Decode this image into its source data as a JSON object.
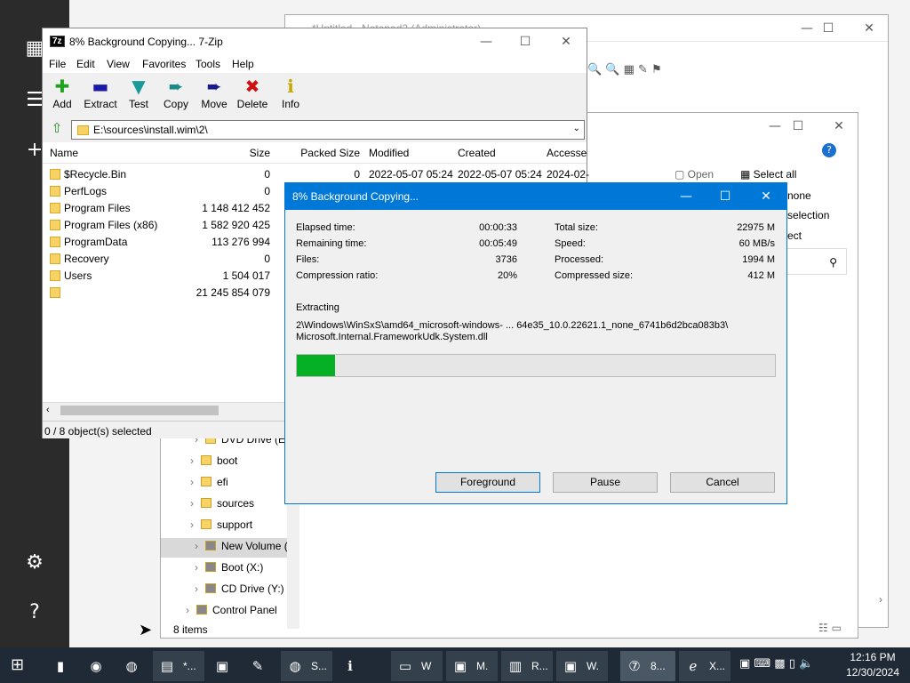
{
  "left_panel": {
    "icons": [
      "grid-icon",
      "menu-icon",
      "plus-icon",
      "sliders-icon",
      "help-icon"
    ]
  },
  "notepad": {
    "title": "*Untitled - Notepad2 (Administrator)"
  },
  "explorer": {
    "ribbon": {
      "open": "Open",
      "select_all": "Select all",
      "select_none": "none",
      "invert": "selection",
      "select_label": "ect"
    },
    "tree": [
      {
        "label": "DVD Drive (E:)"
      },
      {
        "label": "boot"
      },
      {
        "label": "efi"
      },
      {
        "label": "sources"
      },
      {
        "label": "support"
      },
      {
        "label": "New Volume (F"
      },
      {
        "label": "Boot (X:)"
      },
      {
        "label": "CD Drive (Y:) H"
      },
      {
        "label": "Control Panel"
      }
    ],
    "status": "8 items"
  },
  "sevenzip": {
    "title": "8% Background Copying... 7-Zip",
    "menu": [
      "File",
      "Edit",
      "View",
      "Favorites",
      "Tools",
      "Help"
    ],
    "toolbar": [
      {
        "label": "Add",
        "icon": "plus-icon",
        "color": "#1fa31f"
      },
      {
        "label": "Extract",
        "icon": "minus-icon",
        "color": "#1a1aa8"
      },
      {
        "label": "Test",
        "icon": "check-icon",
        "color": "#1a9a9a"
      },
      {
        "label": "Copy",
        "icon": "arrow-right-icon",
        "color": "#1a8a8a"
      },
      {
        "label": "Move",
        "icon": "arrow-right-icon",
        "color": "#1a1a8a"
      },
      {
        "label": "Delete",
        "icon": "x-icon",
        "color": "#d01010"
      },
      {
        "label": "Info",
        "icon": "info-icon",
        "color": "#c9a600"
      }
    ],
    "address": "E:\\sources\\install.wim\\2\\",
    "columns": [
      "Name",
      "Size",
      "Packed Size",
      "Modified",
      "Created",
      "Accesse"
    ],
    "rows": [
      {
        "name": "$Recycle.Bin",
        "size": "0",
        "packed": "0",
        "modified": "2022-05-07 05:24",
        "created": "2022-05-07 05:24",
        "accessed": "2024-02-"
      },
      {
        "name": "PerfLogs",
        "size": "0",
        "packed": "",
        "modified": "",
        "created": "",
        "accessed": ""
      },
      {
        "name": "Program Files",
        "size": "1 148 412 452",
        "packed": "",
        "modified": "",
        "created": "",
        "accessed": ""
      },
      {
        "name": "Program Files (x86)",
        "size": "1 582 920 425",
        "packed": "",
        "modified": "",
        "created": "",
        "accessed": ""
      },
      {
        "name": "ProgramData",
        "size": "113 276 994",
        "packed": "",
        "modified": "",
        "created": "",
        "accessed": ""
      },
      {
        "name": "Recovery",
        "size": "0",
        "packed": "",
        "modified": "",
        "created": "",
        "accessed": ""
      },
      {
        "name": "Users",
        "size": "1 504 017",
        "packed": "",
        "modified": "",
        "created": "",
        "accessed": ""
      },
      {
        "name": "",
        "size": "21 245 854 079",
        "packed": "",
        "modified": "",
        "created": "",
        "accessed": ""
      }
    ],
    "status": "0 / 8 object(s) selected"
  },
  "progress": {
    "title": "8% Background Copying...",
    "left": [
      {
        "label": "Elapsed time:",
        "value": "00:00:33"
      },
      {
        "label": "Remaining time:",
        "value": "00:05:49"
      },
      {
        "label": "Files:",
        "value": "3736"
      },
      {
        "label": "Compression ratio:",
        "value": "20%"
      }
    ],
    "right": [
      {
        "label": "Total size:",
        "value": "22975 M"
      },
      {
        "label": "Speed:",
        "value": "60 MB/s"
      },
      {
        "label": "Processed:",
        "value": "1994 M"
      },
      {
        "label": "Compressed size:",
        "value": "412 M"
      }
    ],
    "action": "Extracting",
    "path_line1": "2\\Windows\\WinSxS\\amd64_microsoft-windows- ... 64e35_10.0.22621.1_none_6741b6d2bca083b3\\",
    "path_line2": "Microsoft.Internal.FrameworkUdk.System.dll",
    "percent": 8,
    "buttons": {
      "foreground": "Foreground",
      "pause": "Pause",
      "cancel": "Cancel"
    }
  },
  "taskbar": {
    "items": [
      {
        "icon": "cmd-icon",
        "text": ""
      },
      {
        "icon": "chrome-icon",
        "text": ""
      },
      {
        "icon": "firefox-icon",
        "text": ""
      },
      {
        "icon": "notepad-icon",
        "text": "*..."
      },
      {
        "icon": "app-icon",
        "text": ""
      },
      {
        "icon": "paint-icon",
        "text": ""
      },
      {
        "icon": "firefox-icon",
        "text": "S..."
      },
      {
        "icon": "info-icon",
        "text": ""
      },
      {
        "icon": "drive-icon",
        "text": "W"
      },
      {
        "icon": "app-icon",
        "text": "M."
      },
      {
        "icon": "chart-icon",
        "text": "R..."
      },
      {
        "icon": "app-icon",
        "text": "W."
      },
      {
        "icon": "sevenzip-icon",
        "text": "8..."
      },
      {
        "icon": "ie-icon",
        "text": "X..."
      }
    ],
    "time": "12:16 PM",
    "date": "12/30/2024"
  }
}
